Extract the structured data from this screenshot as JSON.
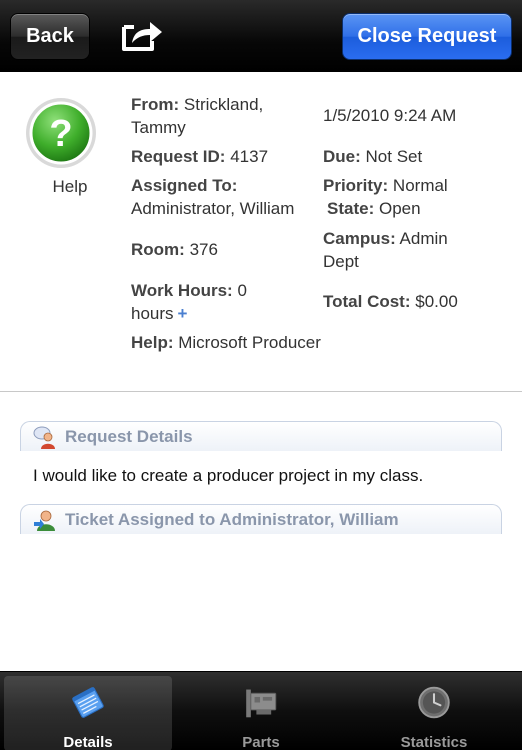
{
  "nav": {
    "back_label": "Back",
    "share_icon": "share-arrow-icon",
    "close_label": "Close Request"
  },
  "header": {
    "help_icon": "question-mark-icon",
    "help_label": "Help",
    "from_label": "From:",
    "from_value": "Strickland, Tammy",
    "date": "1/5/2010 9:24 AM",
    "request_id_label": "Request ID:",
    "request_id_value": "4137",
    "due_label": "Due:",
    "due_value": "Not Set",
    "assigned_label": "Assigned To:",
    "assigned_value": "Administrator, William",
    "priority_label": "Priority:",
    "priority_value": "Normal",
    "state_label": "State:",
    "state_value": "Open",
    "campus_label": "Campus:",
    "campus_value": "Admin Dept",
    "room_label": "Room:",
    "room_value": "376",
    "work_hours_label": "Work Hours:",
    "work_hours_value": "0 hours",
    "work_hours_add": "+",
    "total_cost_label": "Total Cost:",
    "total_cost_value": "$0.00",
    "help_field_label": "Help:",
    "help_field_value": "Microsoft Producer"
  },
  "sections": [
    {
      "icon": "user-speech-icon",
      "title": "Request Details",
      "body": "I would like to create a producer project in my class."
    },
    {
      "icon": "user-assign-icon",
      "title": "Ticket Assigned to Administrator, William"
    }
  ],
  "tabs": [
    {
      "label": "Details",
      "icon": "notepad-icon",
      "active": true
    },
    {
      "label": "Parts",
      "icon": "circuit-card-icon",
      "active": false
    },
    {
      "label": "Statistics",
      "icon": "clock-icon",
      "active": false
    }
  ],
  "colors": {
    "close_button": "#2f6fe8",
    "section_title": "#8a96ab",
    "tab_active": "#ffffff",
    "tab_inactive": "#9a9a9a"
  }
}
